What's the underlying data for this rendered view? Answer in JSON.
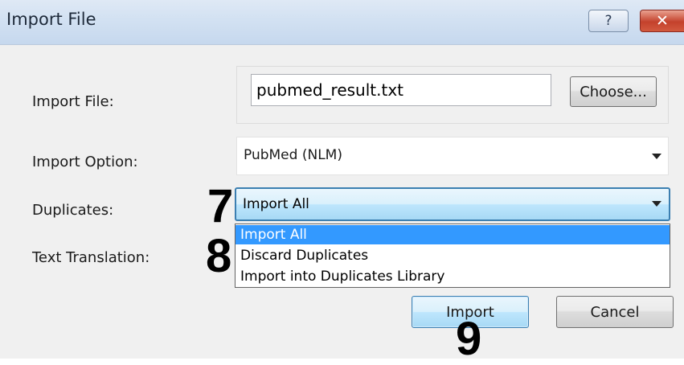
{
  "window": {
    "title": "Import File",
    "help_label": "?",
    "close_label": "✕"
  },
  "form": {
    "import_file": {
      "label": "Import File:",
      "value": "pubmed_result.txt",
      "button_label": "Choose..."
    },
    "import_option": {
      "label": "Import Option:",
      "value": "PubMed (NLM)"
    },
    "duplicates": {
      "label": "Duplicates:",
      "value": "Import All",
      "options": [
        "Import All",
        "Discard Duplicates",
        "Import into Duplicates Library"
      ],
      "highlighted_index": 0
    },
    "text_translation": {
      "label": "Text Translation:"
    }
  },
  "buttons": {
    "import": "Import",
    "cancel": "Cancel"
  },
  "annotations": {
    "step_7": "7",
    "step_8": "8",
    "step_9": "9"
  },
  "colors": {
    "selection": "#3399ff",
    "focus_border": "#3c7fb1",
    "close_button": "#c4412c"
  }
}
